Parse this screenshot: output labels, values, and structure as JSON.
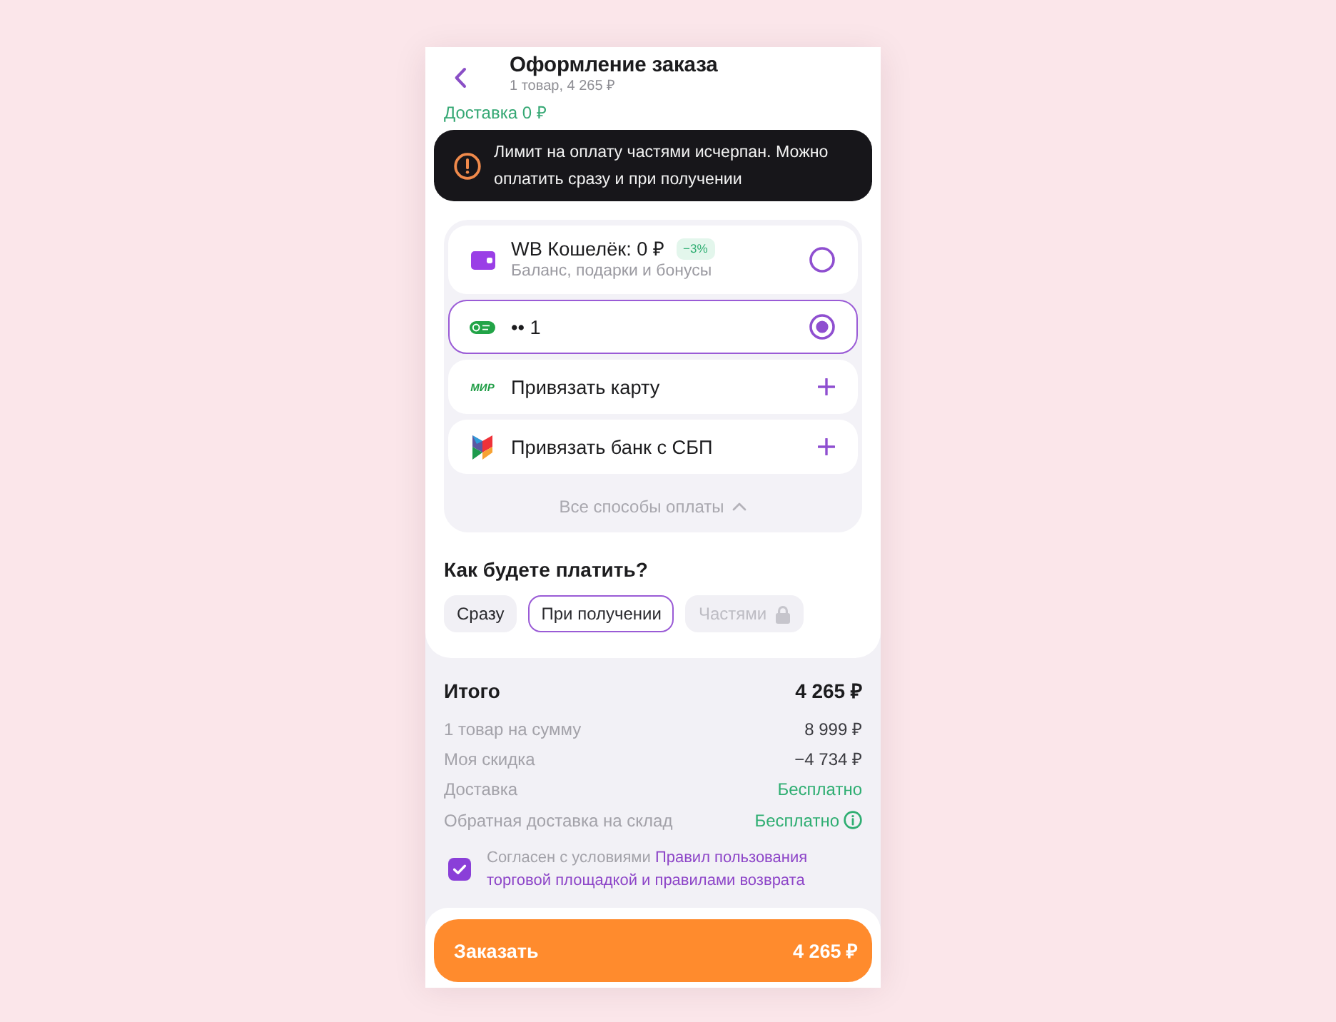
{
  "header": {
    "title": "Оформление заказа",
    "subtitle": "1 товар, 4 265 ₽"
  },
  "delivery": "Доставка 0 ₽",
  "notice": {
    "text": "Лимит на оплату частями исчерпан. Можно оплатить сразу и при получении"
  },
  "payment_methods": [
    {
      "kind": "wallet",
      "title": "WB Кошелёк: 0 ₽",
      "badge": "−3%",
      "subtitle": "Баланс, подарки и бонусы",
      "selected": false
    },
    {
      "kind": "saved_card",
      "title": "•• 1",
      "selected": true
    },
    {
      "kind": "new_card",
      "logo_text": "МИР",
      "title": "Привязать карту",
      "selected": false
    },
    {
      "kind": "new_bank",
      "title": "Привязать банк с СБП",
      "selected": false
    }
  ],
  "all_methods": {
    "label": "Все способы оплаты",
    "expanded": true
  },
  "pay_question": "Как будете платить?",
  "pay_options": [
    {
      "label": "Сразу",
      "selected": false,
      "disabled": false
    },
    {
      "label": "При получении",
      "selected": true,
      "disabled": false
    },
    {
      "label": "Частями",
      "selected": false,
      "disabled": true
    }
  ],
  "summary": {
    "total": {
      "label": "Итого",
      "value": "4 265 ₽"
    },
    "lines": [
      {
        "label": "1 товар на сумму",
        "value": "8 999 ₽",
        "kind": "plain",
        "info": false
      },
      {
        "label": "Моя скидка",
        "value": "−4 734 ₽",
        "kind": "plain",
        "info": false
      },
      {
        "label": "Доставка",
        "value": "Бесплатно",
        "kind": "free",
        "info": false
      },
      {
        "label": "Обратная доставка на склад",
        "value": "Бесплатно",
        "kind": "free",
        "info": true
      }
    ]
  },
  "agreement": {
    "checked": true,
    "text": "Согласен с условиями",
    "link": [
      "Правил пользования",
      "торговой площадкой и правилами возврата"
    ]
  },
  "order_button": {
    "label": "Заказать",
    "amount": "4 265 ₽"
  }
}
